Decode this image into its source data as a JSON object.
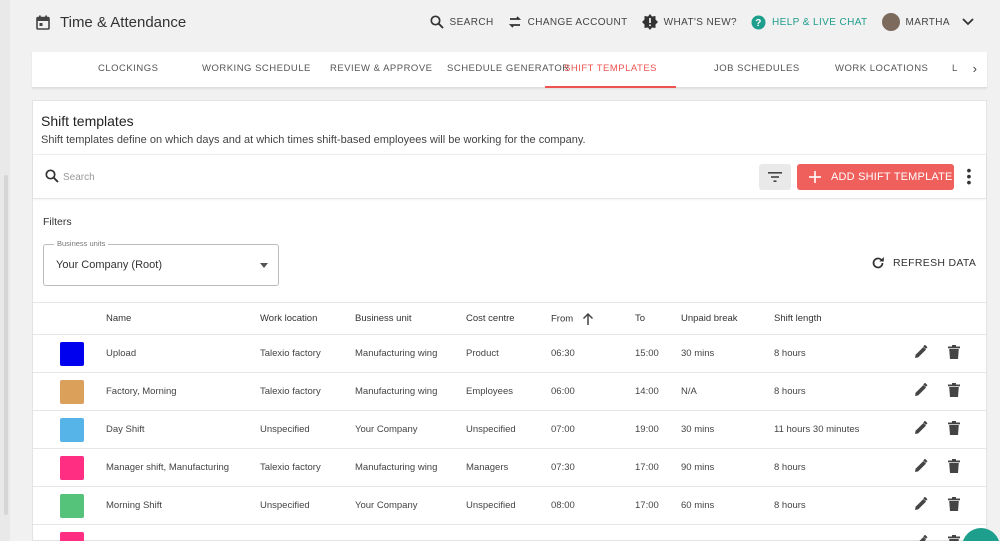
{
  "app": {
    "title": "Time & Attendance",
    "icon": "calendar-icon"
  },
  "top_actions": [
    {
      "label": "SEARCH",
      "icon": "search-icon"
    },
    {
      "label": "CHANGE ACCOUNT",
      "icon": "swap-icon"
    },
    {
      "label": "WHAT'S NEW?",
      "icon": "news-badge-icon"
    },
    {
      "label": "HELP & LIVE CHAT",
      "icon": "help-icon"
    },
    {
      "label": "MARTHA",
      "icon": "avatar"
    }
  ],
  "tabs": [
    {
      "label": "CLOCKINGS"
    },
    {
      "label": "WORKING SCHEDULE"
    },
    {
      "label": "REVIEW & APPROVE"
    },
    {
      "label": "SCHEDULE GENERATOR"
    },
    {
      "label": "SHIFT TEMPLATES",
      "active": true
    },
    {
      "label": "JOB SCHEDULES"
    },
    {
      "label": "WORK LOCATIONS"
    },
    {
      "label": "L"
    }
  ],
  "page": {
    "title": "Shift templates",
    "description": "Shift templates define on which days and at which times shift-based employees will be working for the company."
  },
  "toolbar": {
    "search_placeholder": "Search",
    "add_label": "ADD SHIFT TEMPLATE"
  },
  "filters": {
    "label": "Filters",
    "business_units_label": "Business units",
    "business_units_value": "Your Company (Root)",
    "refresh_label": "REFRESH DATA"
  },
  "table": {
    "columns": [
      "Name",
      "Work location",
      "Business unit",
      "Cost centre",
      "From",
      "To",
      "Unpaid break",
      "Shift length"
    ],
    "sorted_column": "From",
    "rows": [
      {
        "color": "#0000ee",
        "name": "Upload",
        "location": "Talexio factory",
        "unit": "Manufacturing wing",
        "cost": "Product",
        "from": "06:30",
        "to": "15:00",
        "break": "30 mins",
        "length": "8 hours"
      },
      {
        "color": "#dba05a",
        "name": "Factory, Morning",
        "location": "Talexio factory",
        "unit": "Manufacturing wing",
        "cost": "Employees",
        "from": "06:00",
        "to": "14:00",
        "break": "N/A",
        "length": "8 hours"
      },
      {
        "color": "#57b4e8",
        "name": "Day Shift",
        "location": "Unspecified",
        "unit": "Your Company",
        "cost": "Unspecified",
        "from": "07:00",
        "to": "19:00",
        "break": "30 mins",
        "length": "11 hours 30 minutes"
      },
      {
        "color": "#ff2e82",
        "name": "Manager shift, Manufacturing",
        "location": "Talexio factory",
        "unit": "Manufacturing wing",
        "cost": "Managers",
        "from": "07:30",
        "to": "17:00",
        "break": "90 mins",
        "length": "8 hours"
      },
      {
        "color": "#55c47a",
        "name": "Morning Shift",
        "location": "Unspecified",
        "unit": "Your Company",
        "cost": "Unspecified",
        "from": "08:00",
        "to": "17:00",
        "break": "60 mins",
        "length": "8 hours"
      },
      {
        "color": "#ff2e82",
        "name": "",
        "location": "",
        "unit": "",
        "cost": "",
        "from": "",
        "to": "",
        "break": "",
        "length": ""
      }
    ]
  }
}
